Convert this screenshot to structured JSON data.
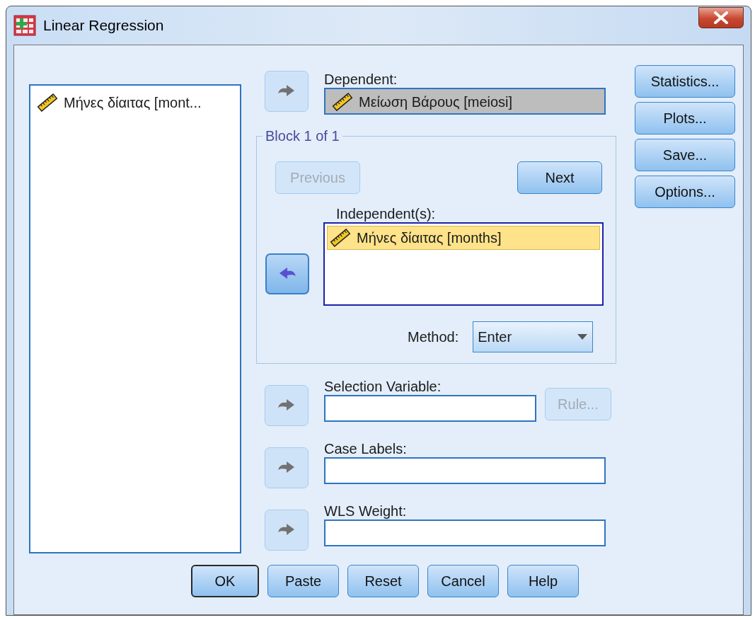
{
  "window": {
    "title": "Linear Regression"
  },
  "variable_list": {
    "items": [
      {
        "label": "Μήνες δίαιτας [mont...",
        "selected": false
      }
    ]
  },
  "dependent": {
    "label": "Dependent:",
    "arrow": {
      "kind": "add",
      "disabled": true
    },
    "items": [
      {
        "label": "Μείωση Βάρους [meiosi]",
        "selected": true
      }
    ]
  },
  "block": {
    "title": "Block 1 of 1",
    "buttons": [
      {
        "label": "Previous",
        "disabled": true
      },
      {
        "label": "Next",
        "disabled": false
      }
    ],
    "arrow": {
      "kind": "remove",
      "disabled": false
    },
    "independents": {
      "label": "Independent(s):",
      "items": [
        {
          "label": "Μήνες δίαιτας [months]",
          "selected": true
        }
      ]
    },
    "method": {
      "label": "Method:",
      "value": "Enter"
    }
  },
  "targets": [
    {
      "label": "Selection Variable:",
      "arrow": {
        "kind": "add",
        "disabled": true
      },
      "rule_button": {
        "label": "Rule...",
        "disabled": true
      }
    },
    {
      "label": "Case Labels:",
      "arrow": {
        "kind": "add",
        "disabled": true
      }
    },
    {
      "label": "WLS Weight:",
      "arrow": {
        "kind": "add",
        "disabled": true
      }
    }
  ],
  "side_buttons": [
    {
      "label": "Statistics..."
    },
    {
      "label": "Plots..."
    },
    {
      "label": "Save..."
    },
    {
      "label": "Options..."
    }
  ],
  "buttons": [
    {
      "label": "OK",
      "default": true
    },
    {
      "label": "Paste",
      "default": false
    },
    {
      "label": "Reset",
      "default": false
    },
    {
      "label": "Cancel",
      "default": false
    },
    {
      "label": "Help",
      "default": false
    }
  ]
}
